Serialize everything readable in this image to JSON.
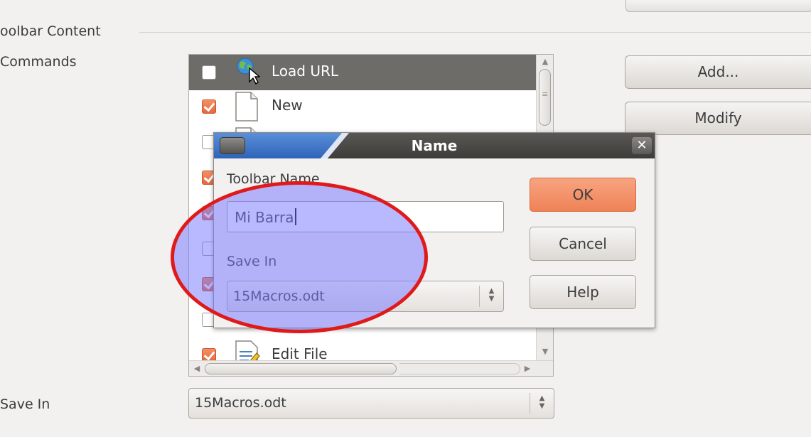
{
  "section": {
    "title": "oolbar Content"
  },
  "commands_label": "Commands",
  "commands": [
    {
      "label": "Load URL",
      "checked": false,
      "selected": true,
      "icon": "globe-icon"
    },
    {
      "label": "New",
      "checked": true,
      "selected": false,
      "icon": "new-document-icon"
    },
    {
      "label": "",
      "checked": false,
      "selected": false,
      "icon": "document-icon"
    },
    {
      "label": "",
      "checked": true,
      "selected": false,
      "icon": ""
    },
    {
      "label": "",
      "checked": true,
      "selected": false,
      "icon": ""
    },
    {
      "label": "",
      "checked": false,
      "selected": false,
      "icon": ""
    },
    {
      "label": "",
      "checked": true,
      "selected": false,
      "icon": ""
    },
    {
      "label": "",
      "checked": false,
      "selected": false,
      "icon": ""
    },
    {
      "label": "Edit File",
      "checked": true,
      "selected": false,
      "icon": "edit-file-icon"
    }
  ],
  "side_buttons": {
    "add": "Add...",
    "modify": "Modify"
  },
  "save_in": {
    "label": "Save In",
    "value": "15Macros.odt"
  },
  "dialog": {
    "title": "Name",
    "toolbar_name_label": "Toolbar Name",
    "toolbar_name_value": "Mi Barra",
    "save_in_label": "Save In",
    "save_in_value": "15Macros.odt",
    "ok": "OK",
    "cancel": "Cancel",
    "help": "Help"
  },
  "colors": {
    "checkbox_checked": "#ea7444",
    "selected_row": "#6d6c69",
    "highlight_border": "#e01a1a",
    "highlight_fill": "#7878ff"
  }
}
